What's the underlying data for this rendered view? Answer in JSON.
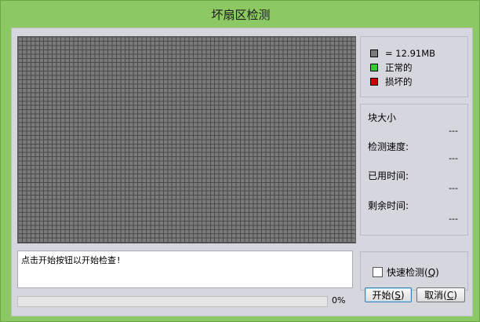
{
  "window": {
    "title": "坏扇区检测"
  },
  "legend": {
    "items": [
      {
        "label": "= 12.91MB",
        "color": "#7b7b7b"
      },
      {
        "label": "正常的",
        "color": "#33cc33"
      },
      {
        "label": "损坏的",
        "color": "#cc0000"
      }
    ]
  },
  "stats": [
    {
      "label": "块大小",
      "value": "---"
    },
    {
      "label": "检测速度:",
      "value": "---"
    },
    {
      "label": "已用时间:",
      "value": "---"
    },
    {
      "label": "剩余时间:",
      "value": "---"
    }
  ],
  "message": "点击开始按钮以开始检查!",
  "progress": {
    "percent_text": "0%",
    "value": 0
  },
  "options": {
    "quick_check_label": "快速检测",
    "quick_check_key": "Q",
    "quick_check_checked": false
  },
  "buttons": {
    "start_label": "开始",
    "start_key": "S",
    "cancel_label": "取消",
    "cancel_key": "C"
  },
  "grid": {
    "cell_color": "#7b7b7b",
    "line_color": "#4a4a4a"
  }
}
